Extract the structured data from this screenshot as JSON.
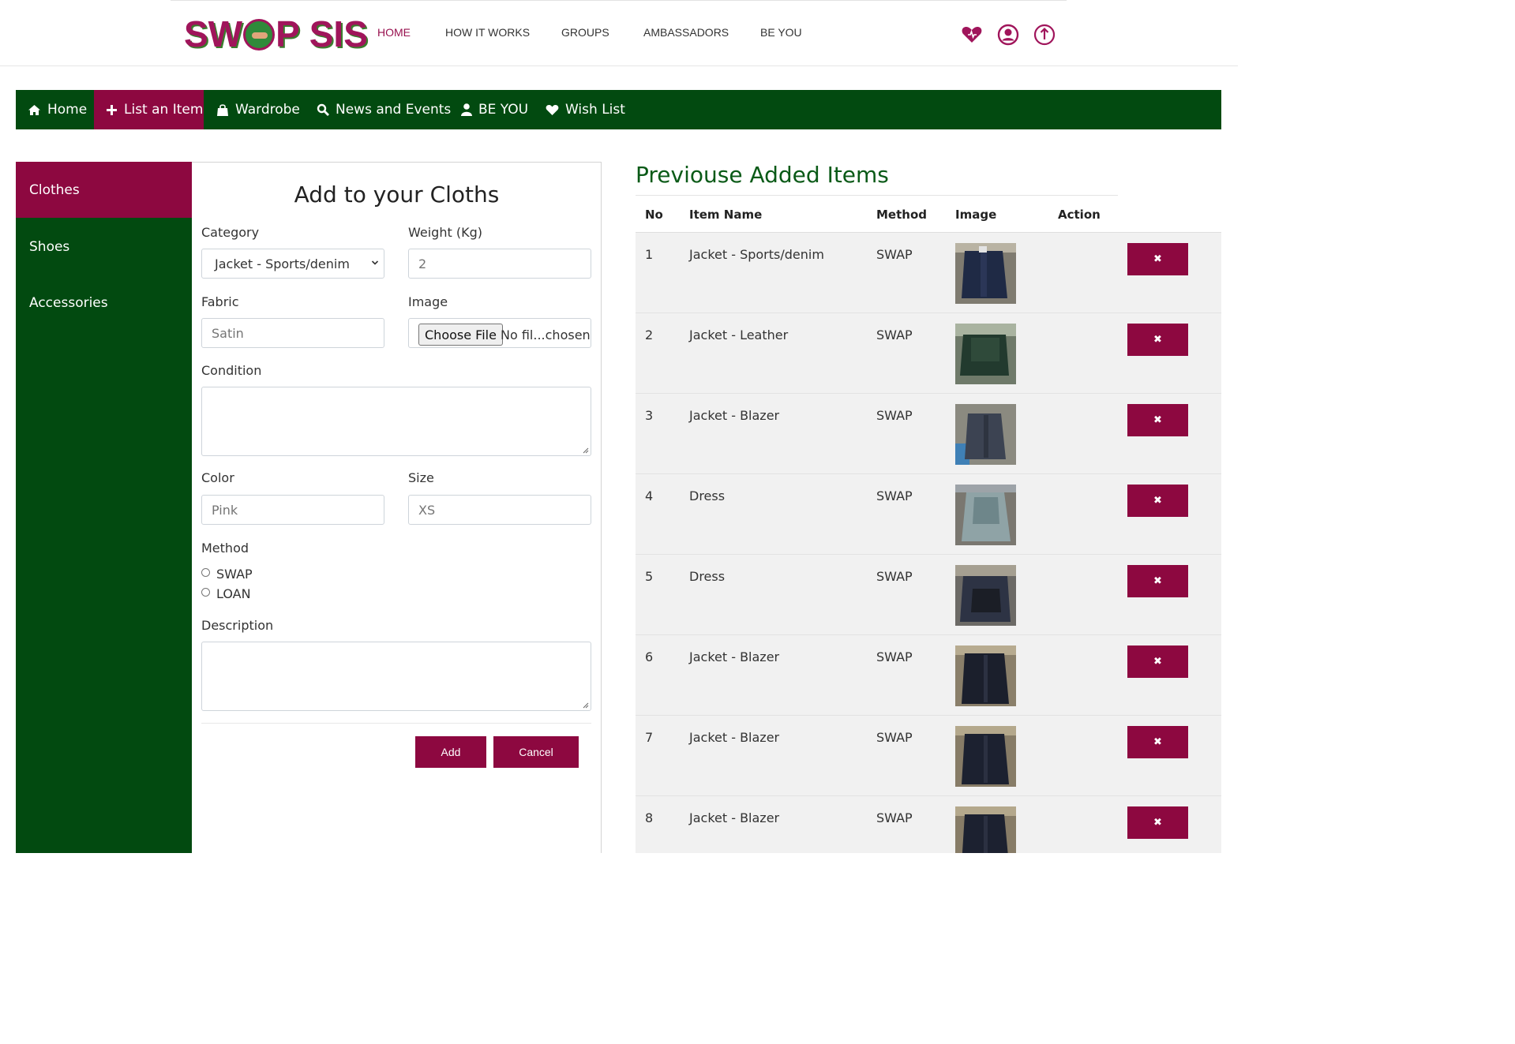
{
  "brand": {
    "logo_text_left": "SW",
    "logo_text_right": "P SIS",
    "colors": {
      "primary": "#8d0840",
      "green": "#024a10"
    }
  },
  "topnav": [
    {
      "label": "HOME",
      "active": true
    },
    {
      "label": "HOW IT WORKS"
    },
    {
      "label": "GROUPS"
    },
    {
      "label": "AMBASSADORS"
    },
    {
      "label": "BE YOU"
    }
  ],
  "topicons": [
    "heart-icon",
    "user-icon",
    "power-icon"
  ],
  "menu": [
    {
      "label": "Home",
      "icon": "home-icon"
    },
    {
      "label": "List an Item",
      "icon": "plus-icon",
      "active": true
    },
    {
      "label": "Wardrobe",
      "icon": "bag-icon"
    },
    {
      "label": "News and Events",
      "icon": "search-icon"
    },
    {
      "label": "BE YOU",
      "icon": "user-icon"
    },
    {
      "label": "Wish List",
      "icon": "heart-icon"
    }
  ],
  "sidebar": [
    {
      "label": "Clothes",
      "active": true
    },
    {
      "label": "Shoes"
    },
    {
      "label": "Accessories"
    }
  ],
  "form": {
    "title": "Add to your Cloths",
    "category_label": "Category",
    "category_value": "Jacket - Sports/denim",
    "weight_label": "Weight (Kg)",
    "weight_placeholder": "2",
    "fabric_label": "Fabric",
    "fabric_placeholder": "Satin",
    "image_label": "Image",
    "file_button": "Choose File",
    "file_status": "No fil...chosen",
    "condition_label": "Condition",
    "color_label": "Color",
    "color_placeholder": "Pink",
    "size_label": "Size",
    "size_placeholder": "XS",
    "method_label": "Method",
    "method_options": [
      "SWAP",
      "LOAN"
    ],
    "description_label": "Description",
    "add_button": "Add",
    "cancel_button": "Cancel"
  },
  "table": {
    "title": "Previouse Added Items",
    "headers": [
      "No",
      "Item Name",
      "Method",
      "Image",
      "Action"
    ],
    "delete_glyph": "✖",
    "rows": [
      {
        "no": "1",
        "name": "Jacket - Sports/denim",
        "method": "SWAP"
      },
      {
        "no": "2",
        "name": "Jacket - Leather",
        "method": "SWAP"
      },
      {
        "no": "3",
        "name": "Jacket - Blazer",
        "method": "SWAP"
      },
      {
        "no": "4",
        "name": "Dress",
        "method": "SWAP"
      },
      {
        "no": "5",
        "name": "Dress",
        "method": "SWAP"
      },
      {
        "no": "6",
        "name": "Jacket - Blazer",
        "method": "SWAP"
      },
      {
        "no": "7",
        "name": "Jacket - Blazer",
        "method": "SWAP"
      },
      {
        "no": "8",
        "name": "Jacket - Blazer",
        "method": "SWAP"
      }
    ]
  }
}
